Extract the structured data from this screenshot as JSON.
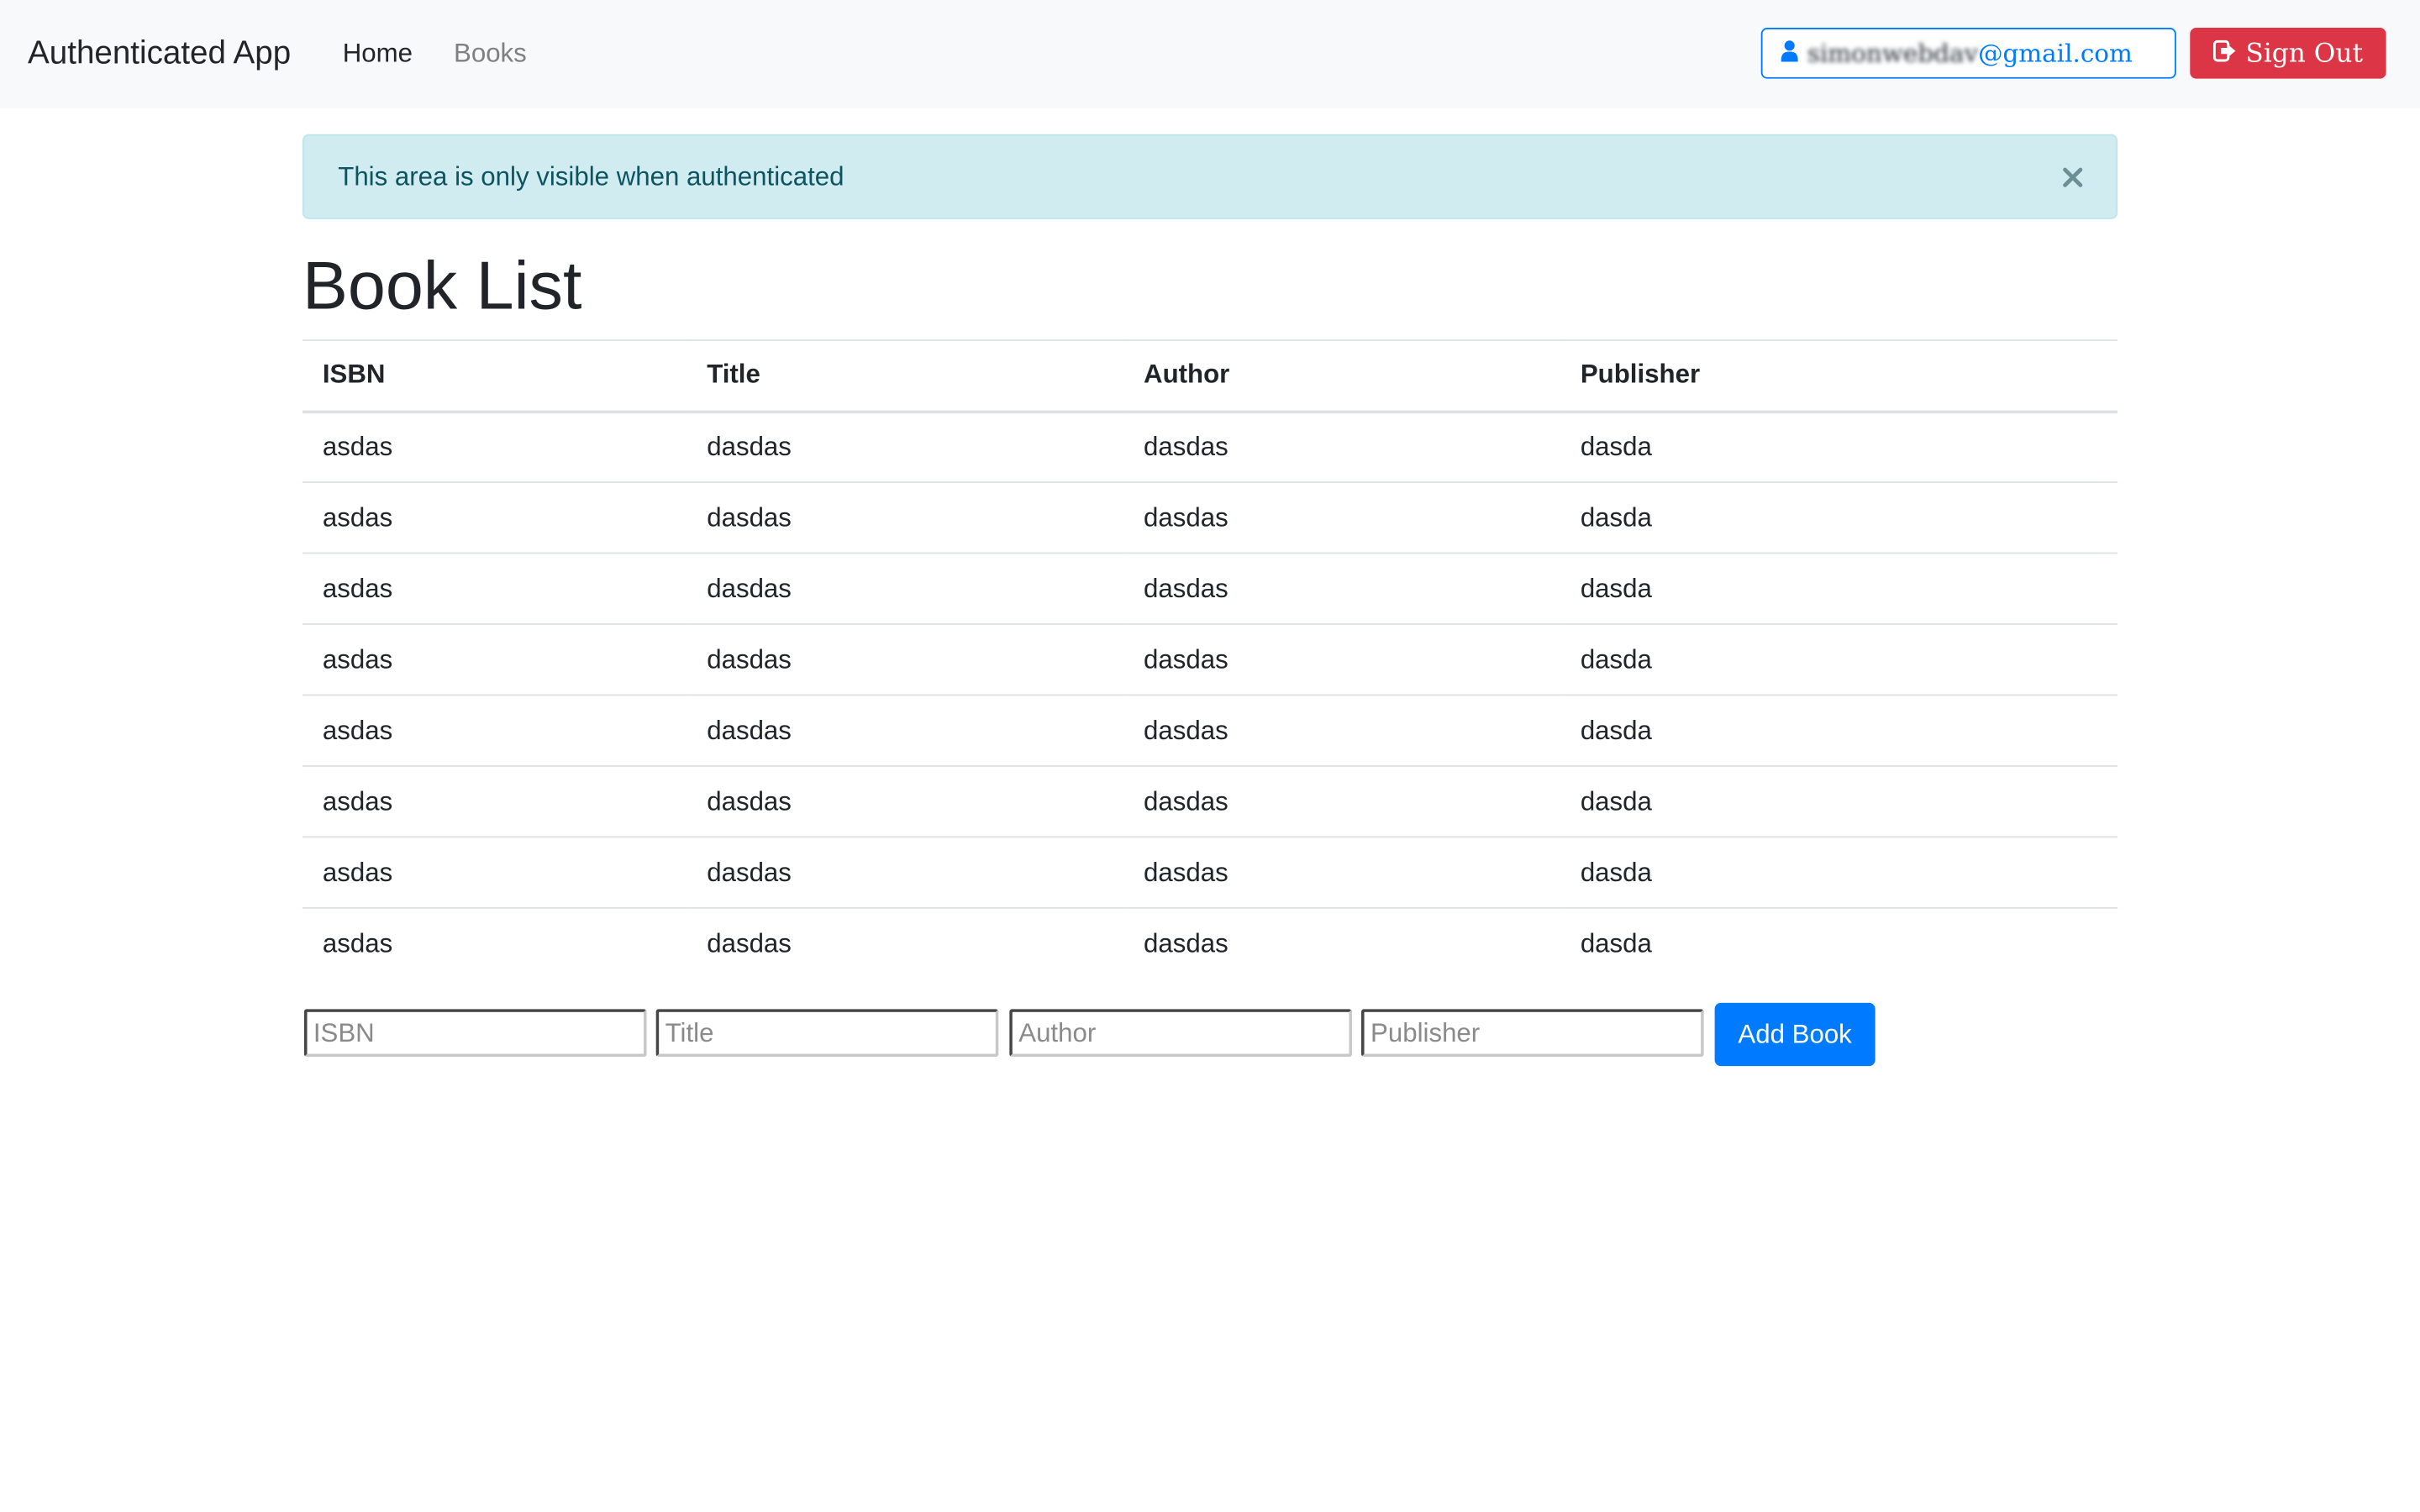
{
  "navbar": {
    "brand": "Authenticated App",
    "links": [
      "Home",
      "Books"
    ],
    "user_email_blurred": "simonwebdav",
    "user_email_domain": "@gmail.com",
    "sign_out_label": "Sign Out"
  },
  "alert": {
    "message": "This area is only visible when authenticated",
    "close_symbol": "×",
    "color": "#d1ecf1"
  },
  "page": {
    "title": "Book List"
  },
  "table": {
    "headers": [
      "ISBN",
      "Title",
      "Author",
      "Publisher"
    ],
    "rows": [
      [
        "asdas",
        "dasdas",
        "dasdas",
        "dasda"
      ],
      [
        "asdas",
        "dasdas",
        "dasdas",
        "dasda"
      ],
      [
        "asdas",
        "dasdas",
        "dasdas",
        "dasda"
      ],
      [
        "asdas",
        "dasdas",
        "dasdas",
        "dasda"
      ],
      [
        "asdas",
        "dasdas",
        "dasdas",
        "dasda"
      ],
      [
        "asdas",
        "dasdas",
        "dasdas",
        "dasda"
      ],
      [
        "asdas",
        "dasdas",
        "dasdas",
        "dasda"
      ],
      [
        "asdas",
        "dasdas",
        "dasdas",
        "dasda"
      ]
    ]
  },
  "form": {
    "isbn_placeholder": "ISBN",
    "title_placeholder": "Title",
    "author_placeholder": "Author",
    "publisher_placeholder": "Publisher",
    "add_label": "Add Book"
  },
  "icons": {
    "user": "user-icon",
    "sign_out": "sign-out-icon",
    "close": "close-icon"
  },
  "colors": {
    "primary": "#007bff",
    "danger": "#dc3545",
    "info_text": "#0c5460"
  }
}
